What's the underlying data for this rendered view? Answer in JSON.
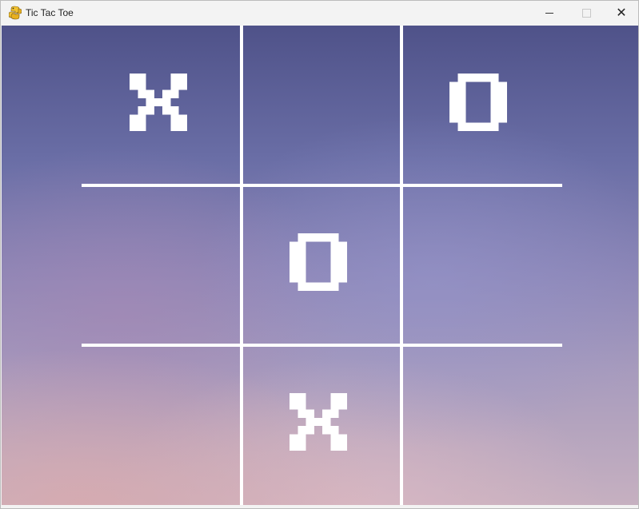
{
  "window": {
    "title": "Tic Tac Toe",
    "app_icon": "python-snake-icon",
    "controls": {
      "minimize_icon": "minimize-icon",
      "maximize_icon": "maximize-icon",
      "close_icon": "close-icon",
      "close_glyph": "✕"
    }
  },
  "board": {
    "line_color": "#ffffff",
    "mark_color": "#ffffff",
    "cells": [
      {
        "row": 1,
        "col": 2,
        "mark": "X"
      },
      {
        "row": 1,
        "col": 3,
        "mark": ""
      },
      {
        "row": 1,
        "col": 4,
        "mark": "O"
      },
      {
        "row": 2,
        "col": 2,
        "mark": ""
      },
      {
        "row": 2,
        "col": 3,
        "mark": "O"
      },
      {
        "row": 2,
        "col": 4,
        "mark": ""
      },
      {
        "row": 3,
        "col": 2,
        "mark": ""
      },
      {
        "row": 3,
        "col": 3,
        "mark": "X"
      },
      {
        "row": 3,
        "col": 4,
        "mark": ""
      }
    ]
  }
}
